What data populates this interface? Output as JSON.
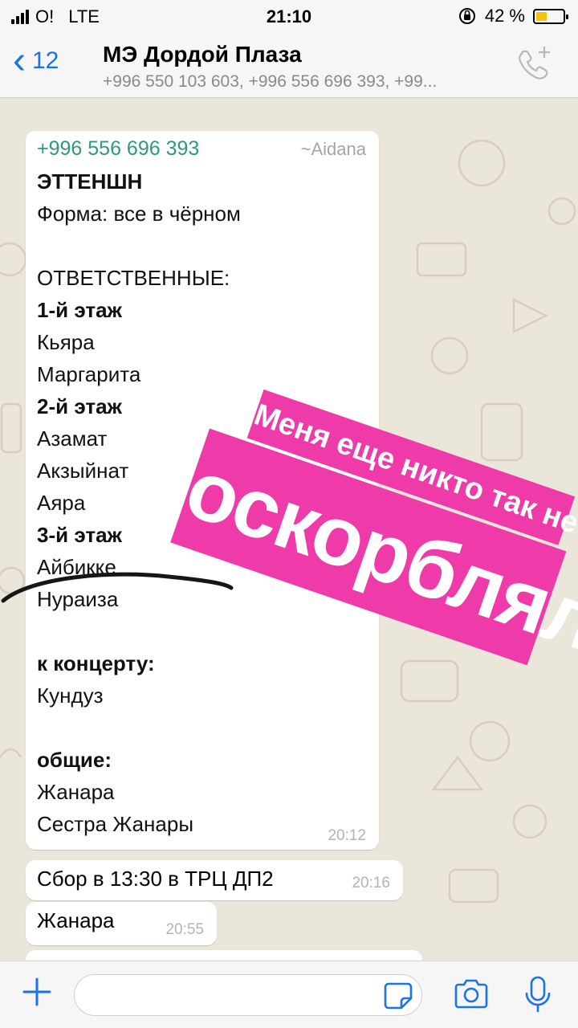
{
  "status_bar": {
    "carrier": "O!",
    "network": "LTE",
    "time": "21:10",
    "battery": "42 %",
    "battery_level": 0.42
  },
  "header": {
    "back_count": "12",
    "title": "МЭ Дордой Плаза",
    "subtitle": "+996 550 103 603, +996 556 696 393, +99..."
  },
  "messages": {
    "main": {
      "sender_phone": "+996 556 696 393",
      "sender_name": "~Aidana",
      "lines": [
        {
          "text": "ЭТТЕНШН",
          "bold": true
        },
        {
          "text": "Форма: все в чёрном",
          "bold": false
        },
        {
          "text": "ОТВЕТСТВЕННЫЕ:",
          "bold": false
        },
        {
          "text": "1-й этаж",
          "bold": true
        },
        {
          "text": "Кьяра",
          "bold": false
        },
        {
          "text": "Маргарита",
          "bold": false
        },
        {
          "text": "2-й этаж",
          "bold": true
        },
        {
          "text": "Азамат",
          "bold": false
        },
        {
          "text": "Акзыйнат",
          "bold": false
        },
        {
          "text": "Аяра",
          "bold": false
        },
        {
          "text": "3-й этаж",
          "bold": true
        },
        {
          "text": "Айбикке",
          "bold": false
        },
        {
          "text": "Нураиза",
          "bold": false
        },
        {
          "text": "к концерту:",
          "bold": true
        },
        {
          "text": "Кундуз",
          "bold": false
        },
        {
          "text": "общие:",
          "bold": true
        },
        {
          "text": "Жанара",
          "bold": false
        },
        {
          "text": "Сестра Жанары",
          "bold": false
        }
      ],
      "time": "20:12"
    },
    "second": {
      "text": "Сбор в 13:30 в ТРЦ ДП2",
      "time": "20:16"
    },
    "third": {
      "text": "Жанара",
      "time": "20:55"
    }
  },
  "sticker": {
    "line1": "Меня еще никто так не",
    "line2": "оскорблял.",
    "color": "#ee3ba9"
  },
  "input": {
    "placeholder": ""
  },
  "colors": {
    "accent": "#1a73e8",
    "sender": "#2e9a76"
  }
}
